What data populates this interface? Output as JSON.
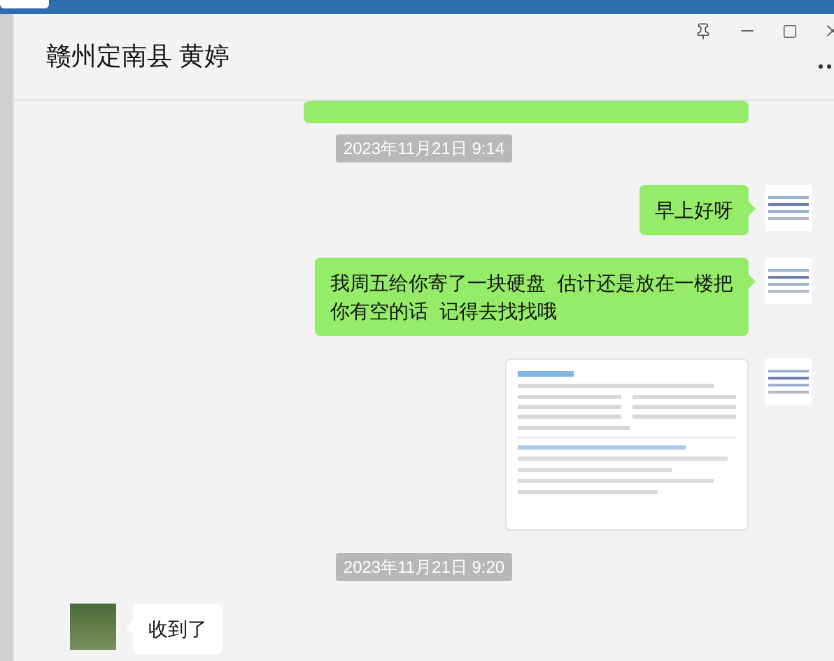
{
  "window": {
    "title": "赣州定南县 黄婷"
  },
  "messages": [
    {
      "kind": "sent_partial"
    },
    {
      "kind": "time",
      "text": "2023年11月21日 9:14"
    },
    {
      "kind": "sent_text",
      "text": "早上好呀"
    },
    {
      "kind": "sent_text",
      "text": "我周五给你寄了一块硬盘  估计还是放在一楼把你有空的话  记得去找找哦"
    },
    {
      "kind": "sent_image"
    },
    {
      "kind": "time",
      "text": "2023年11月21日 9:20"
    },
    {
      "kind": "received_text",
      "text": "收到了"
    }
  ]
}
